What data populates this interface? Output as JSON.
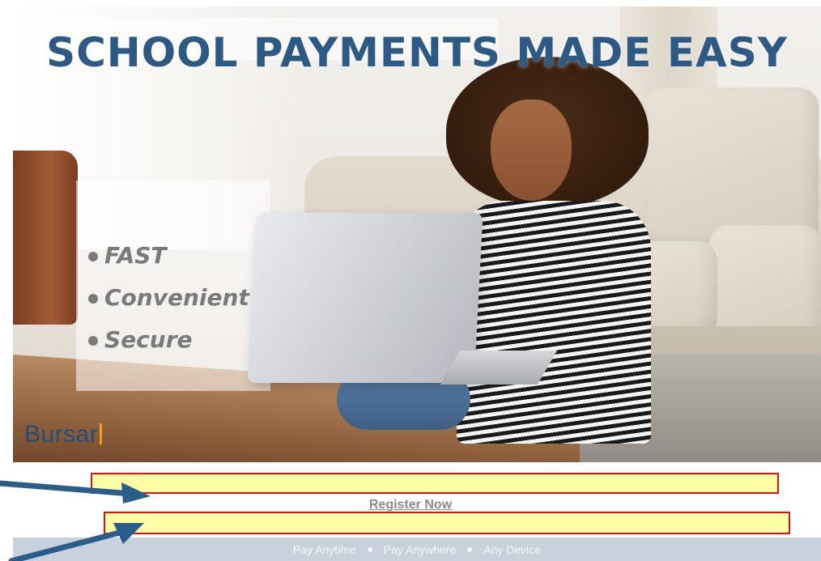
{
  "hero": {
    "headline": "SCHOOL PAYMENTS MADE EASY",
    "features": [
      "FAST",
      "Convenient",
      "Secure"
    ],
    "logo_text": "Bursar"
  },
  "form": {
    "field1_value": "",
    "field2_value": "",
    "register_label": "Register Now"
  },
  "footer": {
    "items": [
      "Pay Anytime",
      "Pay Anywhere",
      "Any Device"
    ]
  },
  "colors": {
    "headline": "#2c5a85",
    "field_highlight": "#ffffa6",
    "field_border": "#e01010",
    "arrow": "#2b5d8a",
    "footer_bar": "#c8d2dd"
  },
  "icons": [
    "annotation-arrow-icon",
    "annotation-arrow-icon"
  ]
}
